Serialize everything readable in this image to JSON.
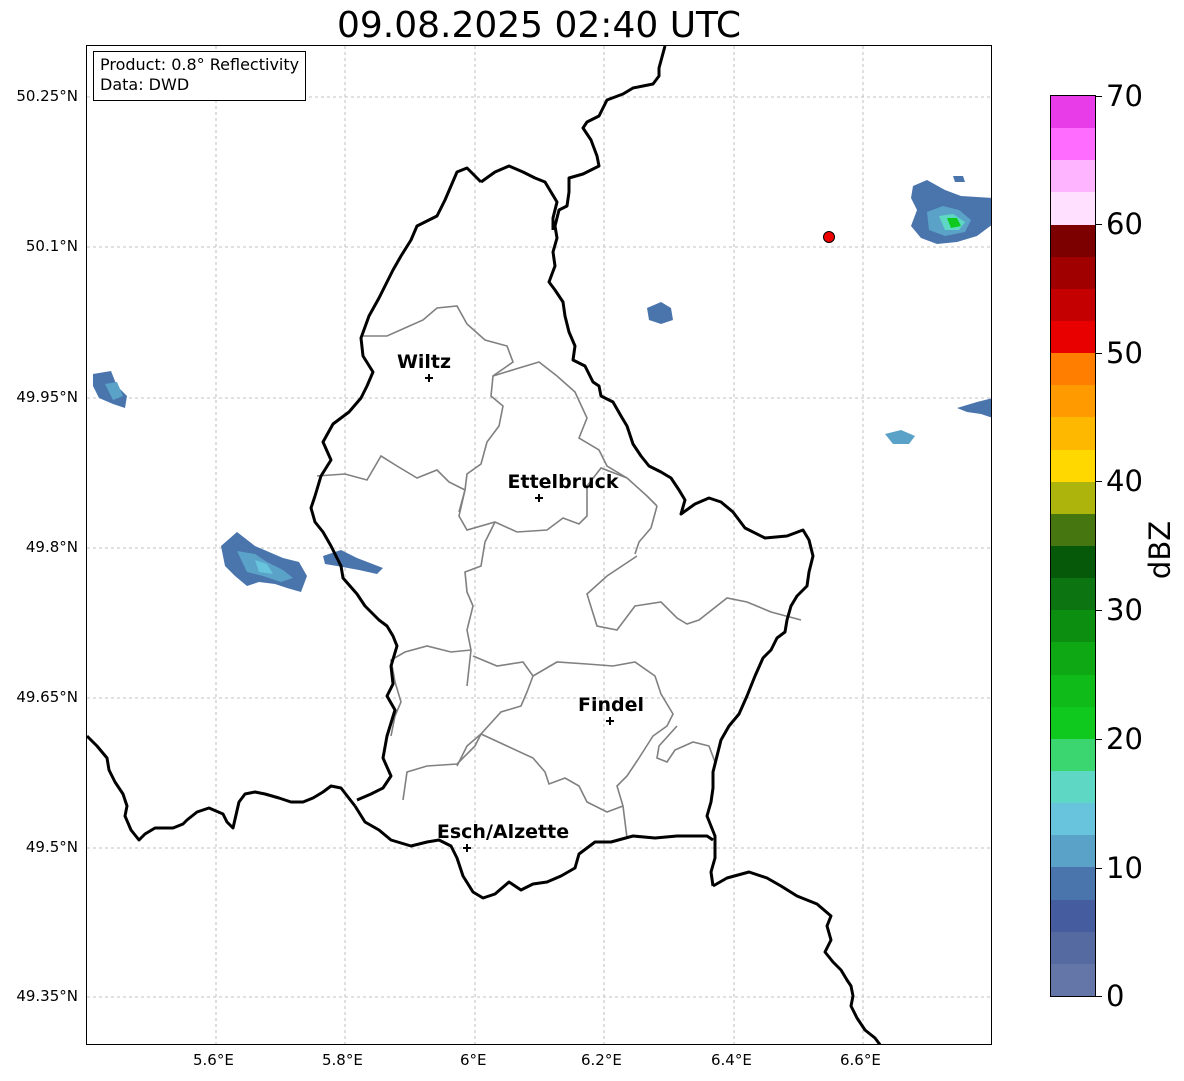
{
  "title": "09.08.2025 02:40 UTC",
  "info": {
    "product": "Product: 0.8° Reflectivity",
    "data_source": "Data: DWD"
  },
  "map": {
    "lon_range": [
      5.4,
      6.8
    ],
    "lat_range": [
      49.3,
      50.3
    ],
    "gridlines": true,
    "lat_labels": [
      "50.25°N",
      "50.1°N",
      "49.95°N",
      "49.8°N",
      "49.65°N",
      "49.5°N",
      "49.35°N"
    ],
    "lon_labels": [
      "5.6°E",
      "5.8°E",
      "6°E",
      "6.2°E",
      "6.4°E",
      "6.6°E"
    ],
    "cities": [
      {
        "name": "Wiltz",
        "lon": 5.93,
        "lat": 49.97
      },
      {
        "name": "Ettelbruck",
        "lon": 6.1,
        "lat": 49.85
      },
      {
        "name": "Findel",
        "lon": 6.21,
        "lat": 49.627
      },
      {
        "name": "Esch/Alzette",
        "lon": 5.99,
        "lat": 49.5
      }
    ],
    "radar_site": {
      "symbol": "red-dot",
      "lon": 6.55,
      "lat": 50.11,
      "color": "#ee0000"
    }
  },
  "colorbar": {
    "label": "dBZ",
    "min": 0,
    "max": 70,
    "ticks": [
      "0",
      "10",
      "20",
      "30",
      "40",
      "50",
      "60",
      "70"
    ],
    "colors": [
      "#6476a8",
      "#556aa0",
      "#455d9e",
      "#4a74ac",
      "#5ba2c9",
      "#68c4dd",
      "#5ed8c4",
      "#3cd670",
      "#10c91e",
      "#0fbb18",
      "#0fa815",
      "#0c8f10",
      "#0c7410",
      "#07590a",
      "#457610",
      "#adb40c",
      "#ffd800",
      "#ffb800",
      "#ff9a00",
      "#ff7e00",
      "#e80000",
      "#c40000",
      "#a00000",
      "#7c0000",
      "#ffe0ff",
      "#ffb4ff",
      "#ff6cff",
      "#e83ce8"
    ]
  }
}
